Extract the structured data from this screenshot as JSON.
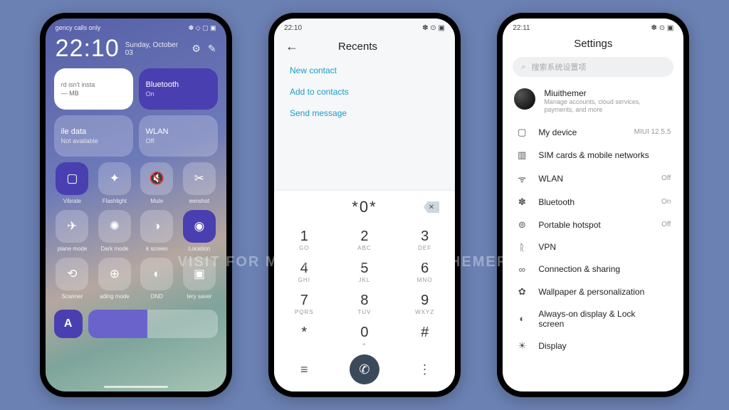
{
  "watermark": "VISIT FOR MORE THEMES - MIUITHEMER.COM",
  "p1": {
    "carrier": "gency calls only",
    "status_icons": "✽ ◇ ▢ ▣",
    "time": "22:10",
    "date": "Sunday, October 03",
    "big": [
      {
        "label": "rd isn't insta",
        "sub": "— MB",
        "style": "bt-white"
      },
      {
        "label": "Bluetooth",
        "sub": "On",
        "style": "bt-indigo"
      },
      {
        "label": "ile data",
        "sub": "Not available",
        "style": "bt-glass"
      },
      {
        "label": "WLAN",
        "sub": "Off",
        "style": "bt-glass"
      }
    ],
    "small": [
      {
        "icon": "▢",
        "label": "Vibrate",
        "active": true
      },
      {
        "icon": "✦",
        "label": "Flashlight"
      },
      {
        "icon": "🔇",
        "label": "Mute"
      },
      {
        "icon": "✂",
        "label": "eenshot"
      },
      {
        "icon": "✈",
        "label": "plane mode"
      },
      {
        "icon": "✺",
        "label": "Dark mode"
      },
      {
        "icon": "◑",
        "label": "k screen"
      },
      {
        "icon": "◉",
        "label": "Location",
        "active": true
      },
      {
        "icon": "⟲",
        "label": "Scanner"
      },
      {
        "icon": "⊕",
        "label": "ading mode"
      },
      {
        "icon": "◐",
        "label": "DND"
      },
      {
        "icon": "▣",
        "label": "tery saver"
      }
    ],
    "slider_letter": "A"
  },
  "p2": {
    "time": "22:10",
    "status_icons": "✽ ⊙ ▣",
    "title": "Recents",
    "actions": [
      "New contact",
      "Add to contacts",
      "Send message"
    ],
    "dialed": "*0*",
    "keys": [
      {
        "d": "1",
        "l": "GO"
      },
      {
        "d": "2",
        "l": "ABC"
      },
      {
        "d": "3",
        "l": "DEF"
      },
      {
        "d": "4",
        "l": "GHI"
      },
      {
        "d": "5",
        "l": "JKL"
      },
      {
        "d": "6",
        "l": "MNO"
      },
      {
        "d": "7",
        "l": "PQRS"
      },
      {
        "d": "8",
        "l": "TUV"
      },
      {
        "d": "9",
        "l": "WXYZ"
      },
      {
        "d": "*",
        "l": ""
      },
      {
        "d": "0",
        "l": "+"
      },
      {
        "d": "#",
        "l": ""
      }
    ]
  },
  "p3": {
    "time": "22:11",
    "status_icons": "✽ ⊙ ▣",
    "title": "Settings",
    "search_placeholder": "搜索系统设置项",
    "account": {
      "name": "Miuithemer",
      "sub": "Manage accounts, cloud services, payments, and more"
    },
    "rows": [
      {
        "icon": "▢",
        "label": "My device",
        "value": "MIUI 12.5.5"
      },
      {
        "icon": "▥",
        "label": "SIM cards & mobile networks",
        "value": ""
      },
      {
        "icon": "ᯤ",
        "label": "WLAN",
        "value": "Off"
      },
      {
        "icon": "✽",
        "label": "Bluetooth",
        "value": "On"
      },
      {
        "icon": "⊚",
        "label": "Portable hotspot",
        "value": "Off"
      },
      {
        "icon": "ᚱ",
        "label": "VPN",
        "value": ""
      },
      {
        "icon": "∞",
        "label": "Connection & sharing",
        "value": ""
      },
      {
        "icon": "✿",
        "label": "Wallpaper & personalization",
        "value": ""
      },
      {
        "icon": "◐",
        "label": "Always-on display & Lock screen",
        "value": ""
      },
      {
        "icon": "☀",
        "label": "Display",
        "value": ""
      }
    ]
  }
}
